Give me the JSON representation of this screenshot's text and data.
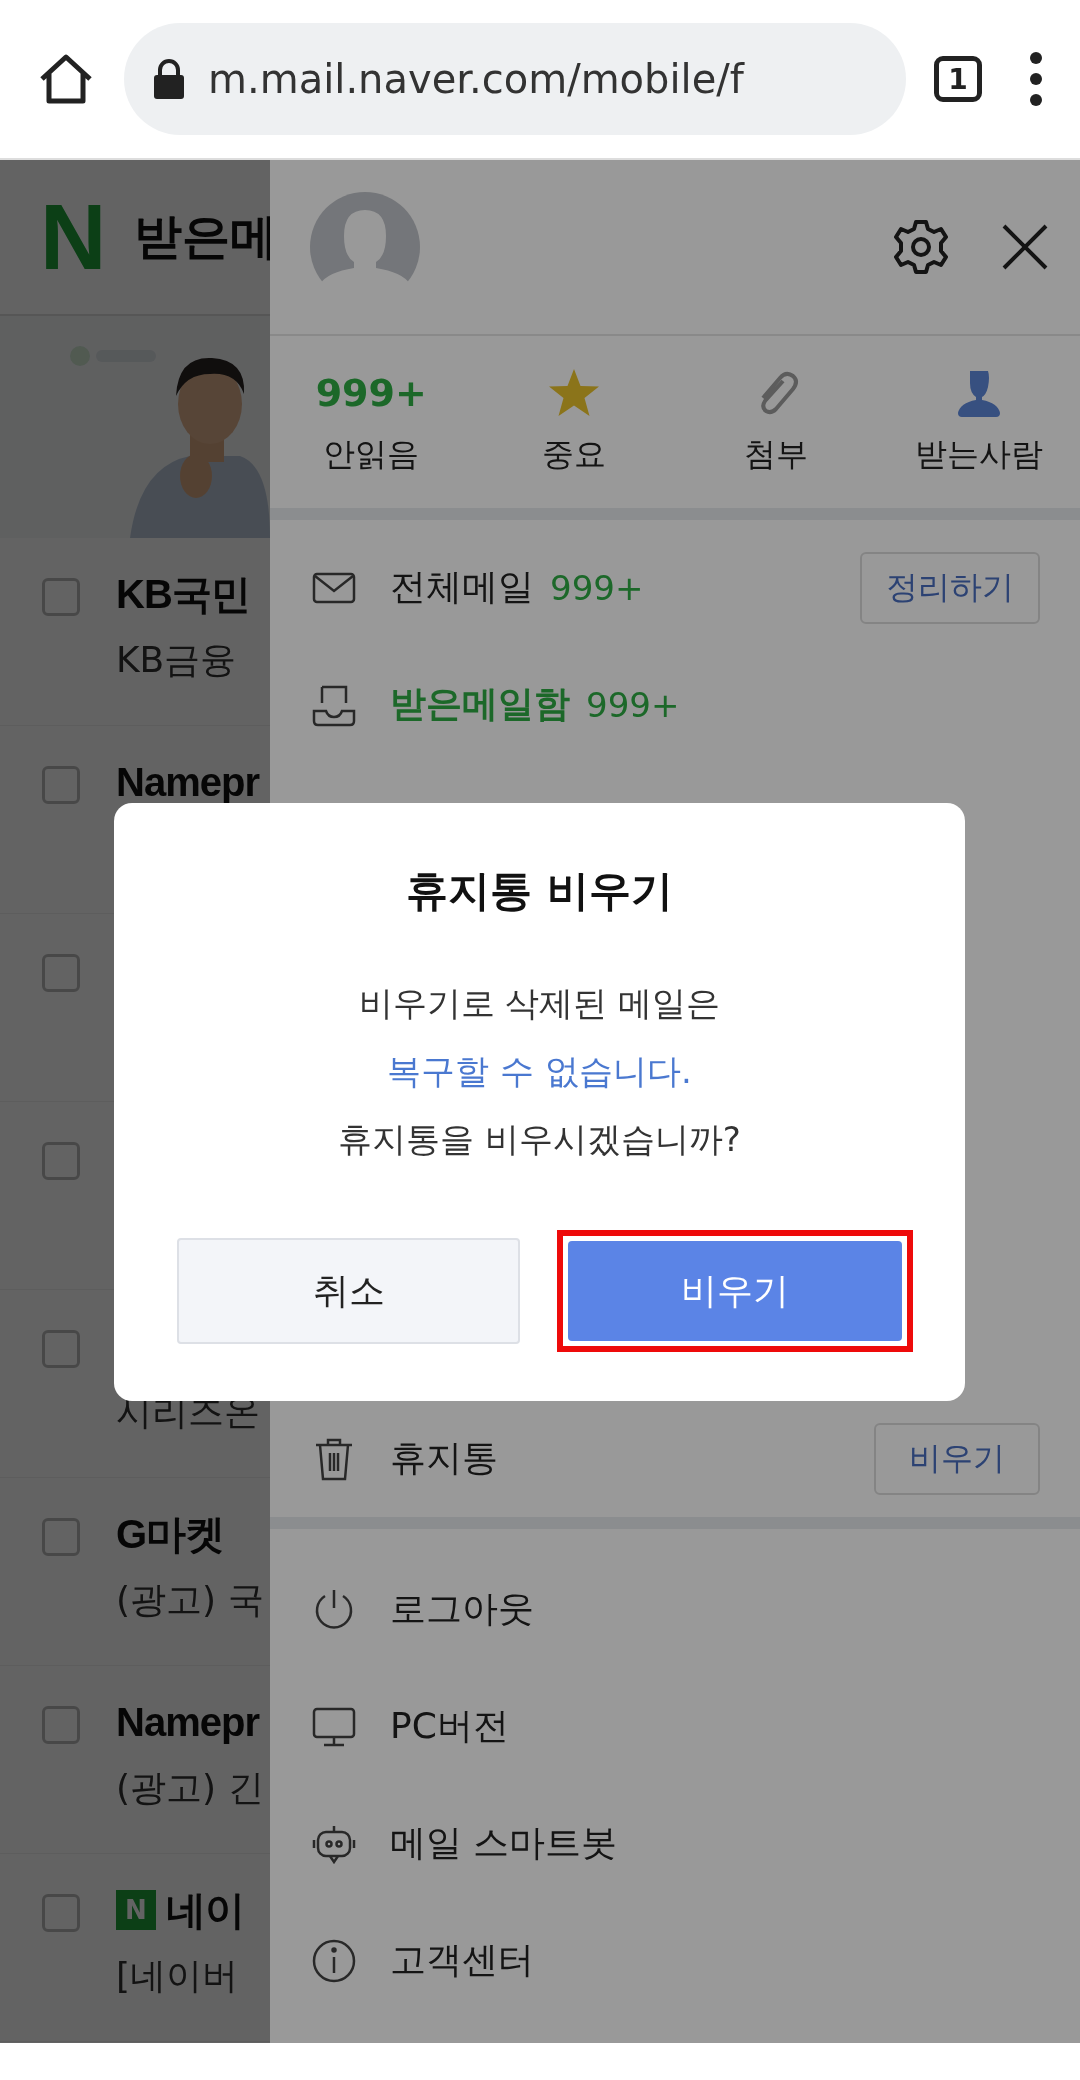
{
  "browser": {
    "url": "m.mail.naver.com/mobile/f",
    "tab_count": "1"
  },
  "mail_list": {
    "logo": "N",
    "title": "받은메",
    "mails": [
      {
        "subject": "KB국민",
        "preview": "KB금융",
        "checked": false
      },
      {
        "subject": "Namepr",
        "checked": false
      },
      {
        "checked": false
      },
      {
        "checked": false
      },
      {
        "preview": "시리즈온",
        "checked": false
      },
      {
        "subject": "G마켓",
        "preview": "(광고) 국",
        "checked": false
      },
      {
        "subject": "Namepr",
        "preview": "(광고) 긴",
        "checked": false
      },
      {
        "badge": "N",
        "subject": "네이",
        "preview": "[네이버",
        "checked": false
      }
    ]
  },
  "drawer": {
    "quick": [
      {
        "kind": "count",
        "count": "999+",
        "label": "안읽음"
      },
      {
        "kind": "star",
        "label": "중요"
      },
      {
        "kind": "clip",
        "label": "첨부"
      },
      {
        "kind": "person",
        "label": "받는사람"
      }
    ],
    "folder_groups": [
      [
        {
          "kind": "mail",
          "label": "전체메일",
          "count": "999+",
          "button": "정리하기",
          "selected": false
        },
        {
          "kind": "inbox",
          "label": "받은메일함",
          "count": "999+",
          "selected": true
        }
      ],
      [
        {
          "kind": "trash",
          "label": "휴지통",
          "button": "비우기",
          "selected": false
        }
      ]
    ],
    "menu": [
      {
        "kind": "power",
        "label": "로그아웃"
      },
      {
        "kind": "monitor",
        "label": "PC버전"
      },
      {
        "kind": "robot",
        "label": "메일 스마트봇"
      },
      {
        "kind": "info",
        "label": "고객센터"
      }
    ]
  },
  "dialog": {
    "title": "휴지통 비우기",
    "lines": [
      {
        "kind": "normal",
        "text": "비우기로 삭제된 메일은"
      },
      {
        "kind": "warning",
        "text": "복구할 수 없습니다."
      },
      {
        "kind": "normal",
        "text": "휴지통을 비우시겠습니까?"
      }
    ],
    "buttons": [
      {
        "kind": "cancel",
        "label": "취소",
        "highlighted": false
      },
      {
        "kind": "confirm",
        "label": "비우기",
        "highlighted": true
      }
    ]
  }
}
